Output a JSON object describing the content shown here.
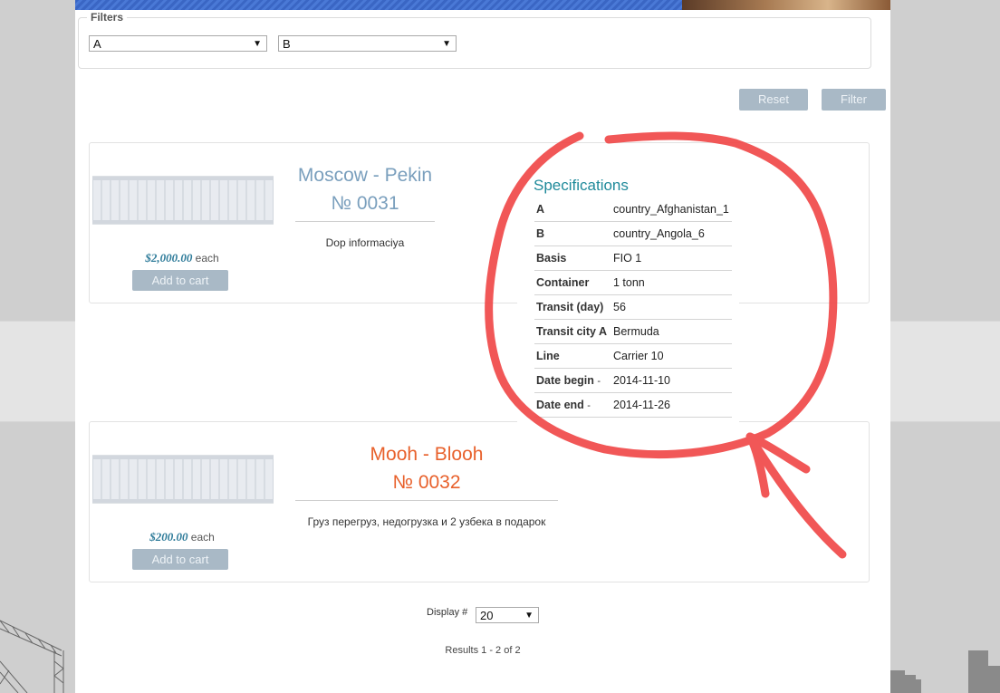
{
  "filters": {
    "legend": "Filters",
    "select_a": "A",
    "select_b": "B",
    "reset_label": "Reset",
    "filter_label": "Filter"
  },
  "products": [
    {
      "title_route": "Moscow - Pekin",
      "title_number": "№ 0031",
      "title_color": "#7a9fbd",
      "description": "Dop informaciya",
      "price": "$2,000.00",
      "price_unit": "each",
      "cart_label": "Add to cart"
    },
    {
      "title_route": "Mooh - Blooh",
      "title_number": "№ 0032",
      "title_color": "#e8612c",
      "description": "Груз перегруз, недогрузка и 2 узбека в подарок",
      "price": "$200.00",
      "price_unit": "each",
      "cart_label": "Add to cart"
    }
  ],
  "specifications": {
    "title": "Specifications",
    "rows": [
      {
        "key": "A",
        "value": "country_Afghanistan_1"
      },
      {
        "key": "B",
        "value": "country_Angola_6"
      },
      {
        "key": "Basis",
        "value": "FIO 1"
      },
      {
        "key": "Container",
        "value": "1 tonn"
      },
      {
        "key": "Transit (day)",
        "value": "56"
      },
      {
        "key": "Transit city A",
        "value": "Bermuda"
      },
      {
        "key": "Line",
        "value": "Carrier 10"
      },
      {
        "key": "Date begin",
        "suffix": "-",
        "value": "2014-11-10"
      },
      {
        "key": "Date end",
        "suffix": "-",
        "value": "2014-11-26"
      }
    ]
  },
  "pagination": {
    "display_label": "Display #",
    "display_value": "20",
    "results_text": "Results 1 - 2 of 2"
  },
  "colors": {
    "accent_teal": "#1f8a9a",
    "button_bg": "#a9b9c6",
    "annotation_red": "#f04545"
  }
}
